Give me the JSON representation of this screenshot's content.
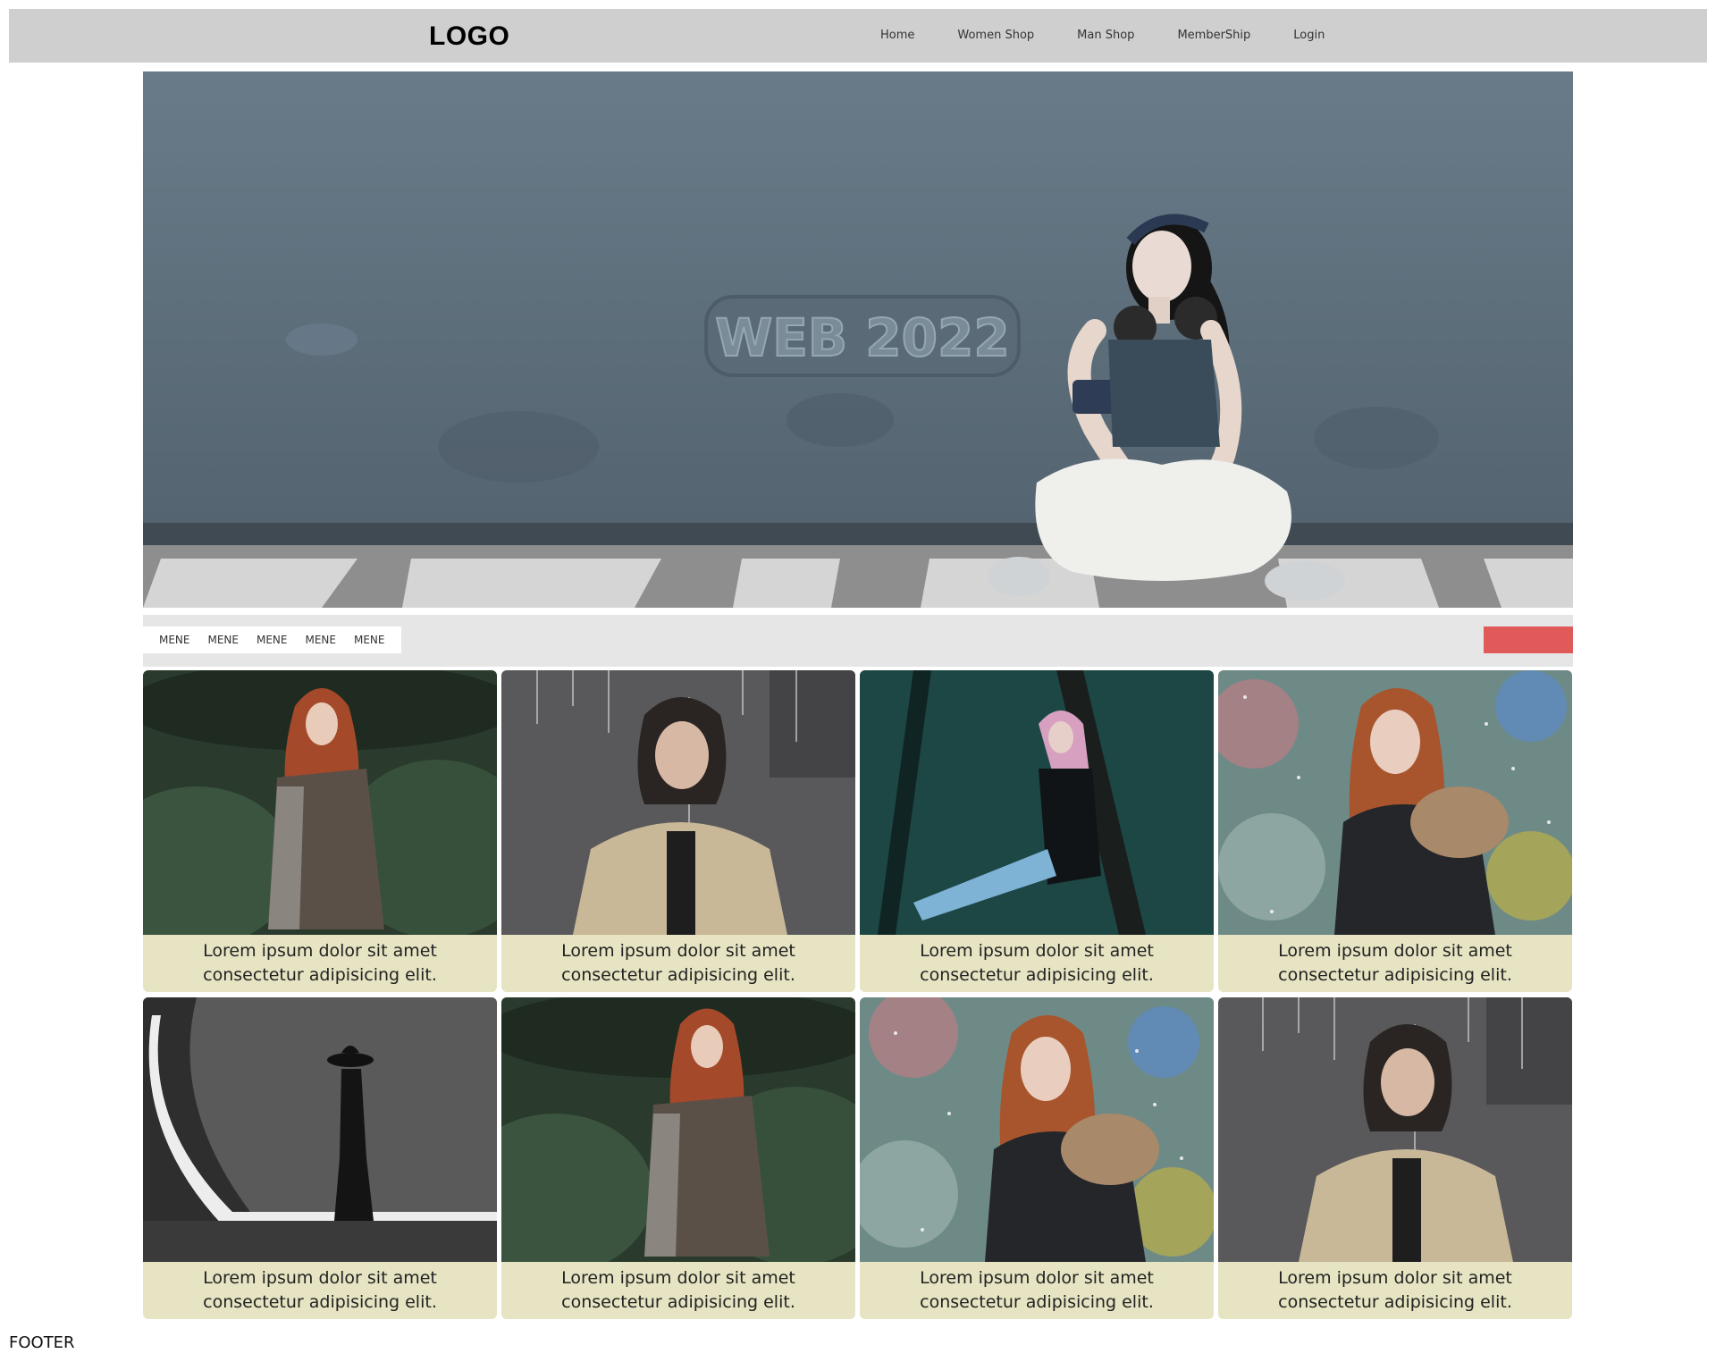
{
  "header": {
    "logo": "LOGO",
    "nav": [
      "Home",
      "Women Shop",
      "Man Shop",
      "MemberShip",
      "Login"
    ]
  },
  "hero": {
    "watermark": "WEB 2022"
  },
  "subbar": {
    "menu": [
      "MENE",
      "MENE",
      "MENE",
      "MENE",
      "MENE"
    ],
    "button_color": "#e05a5a"
  },
  "cards": [
    {
      "caption": "Lorem ipsum dolor sit amet consectetur adipisicing elit.",
      "image": "woman-red-hair-shawl-forest"
    },
    {
      "caption": "Lorem ipsum dolor sit amet consectetur adipisicing elit.",
      "image": "woman-rain-jacket"
    },
    {
      "caption": "Lorem ipsum dolor sit amet consectetur adipisicing elit.",
      "image": "woman-pink-hair-dark-forest"
    },
    {
      "caption": "Lorem ipsum dolor sit amet consectetur adipisicing elit.",
      "image": "woman-fur-hood-snow"
    },
    {
      "caption": "Lorem ipsum dolor sit amet consectetur adipisicing elit.",
      "image": "woman-hat-studio-bw"
    },
    {
      "caption": "Lorem ipsum dolor sit amet consectetur adipisicing elit.",
      "image": "woman-red-hair-shawl-forest"
    },
    {
      "caption": "Lorem ipsum dolor sit amet consectetur adipisicing elit.",
      "image": "woman-fur-hood-snow"
    },
    {
      "caption": "Lorem ipsum dolor sit amet consectetur adipisicing elit.",
      "image": "woman-rain-jacket"
    }
  ],
  "footer": "FOOTER",
  "colors": {
    "header_bg": "#cfcfcf",
    "subbar_bg": "#e6e6e6",
    "caption_bg": "#e6e4c2",
    "accent": "#e05a5a"
  }
}
